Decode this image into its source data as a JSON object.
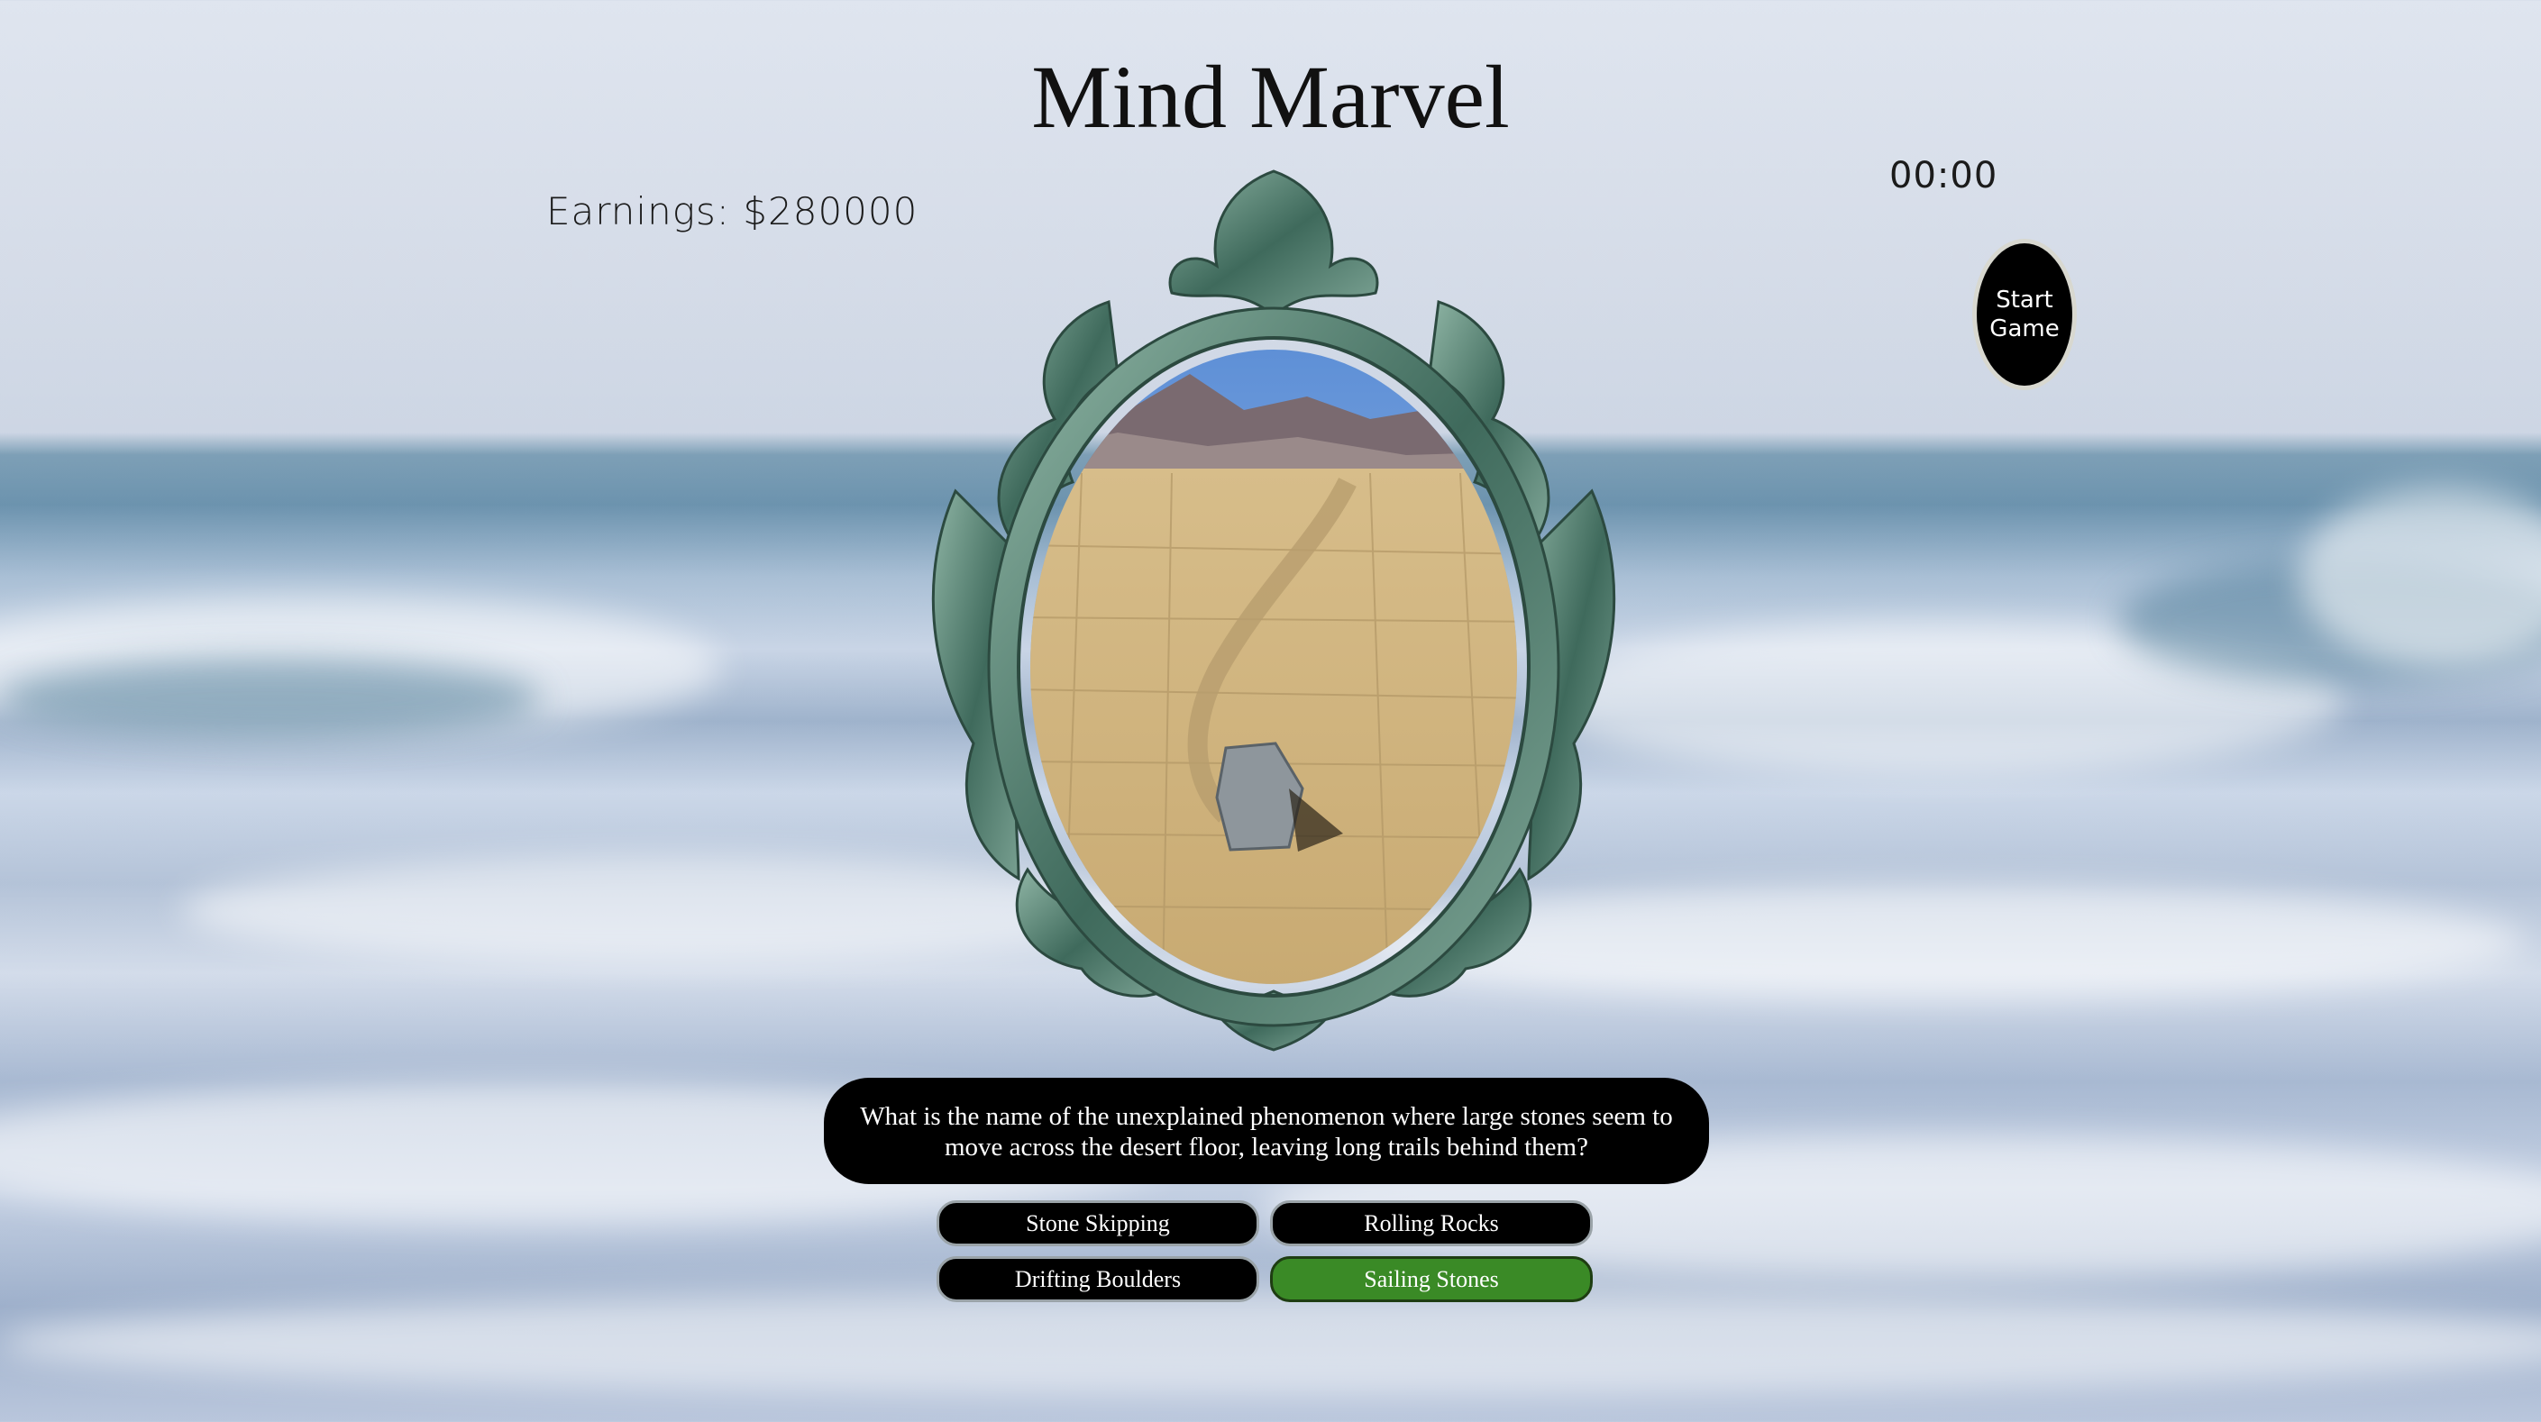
{
  "game": {
    "title": "Mind Marvel",
    "earnings_label": "Earnings: $280000",
    "timer": "00:00",
    "start_button": {
      "line1": "Start",
      "line2": "Game"
    }
  },
  "question": {
    "text": "What is the name of the unexplained phenomenon where large stones seem to move across the desert floor, leaving long trails behind them?"
  },
  "answers": [
    {
      "label": "Stone Skipping",
      "state": "default"
    },
    {
      "label": "Rolling Rocks",
      "state": "default"
    },
    {
      "label": "Drifting Boulders",
      "state": "default"
    },
    {
      "label": "Sailing Stones",
      "state": "correct"
    }
  ],
  "colors": {
    "correct_answer": "#3a8a26",
    "button_bg": "#000000",
    "frame": "#4f7a6a"
  },
  "icons": {
    "mirror_frame": "ornate-mirror-frame",
    "scene": "desert-sailing-stone-image"
  }
}
